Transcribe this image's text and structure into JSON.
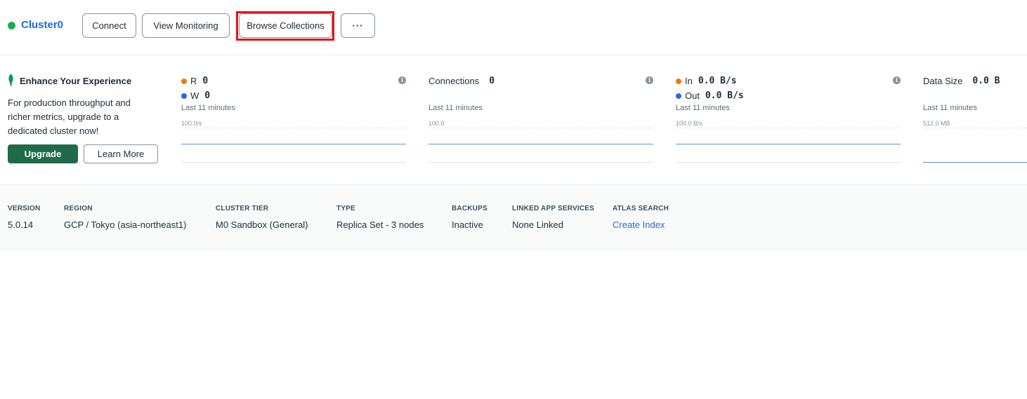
{
  "header": {
    "cluster_name": "Cluster0",
    "connect_label": "Connect",
    "monitoring_label": "View Monitoring",
    "browse_label": "Browse Collections",
    "more_label": "···"
  },
  "promo": {
    "title": "Enhance Your Experience",
    "text": "For production throughput and richer metrics, upgrade to a dedicated cluster now!",
    "upgrade_label": "Upgrade",
    "learn_label": "Learn More"
  },
  "metrics": [
    {
      "line1_label": "R",
      "line1_value": "0",
      "line2_label": "W",
      "line2_value": "0",
      "sub": "Last 11 minutes",
      "scale": "100.0/s",
      "info": "i"
    },
    {
      "line1_label": "Connections",
      "line1_value": "0",
      "sub": "Last 11 minutes",
      "scale": "100.0",
      "info": "i"
    },
    {
      "line1_label": "In",
      "line1_value": "0.0 B/s",
      "line2_label": "Out",
      "line2_value": "0.0 B/s",
      "sub": "Last 11 minutes",
      "scale": "100.0 B/s",
      "info": "i"
    },
    {
      "line1_label": "Data Size",
      "line1_value": "0.0 B",
      "sub": "Last 11 minutes",
      "scale": "512.0 MB"
    }
  ],
  "details": [
    {
      "label": "VERSION",
      "value": "5.0.14"
    },
    {
      "label": "REGION",
      "value": "GCP / Tokyo (asia-northeast1)"
    },
    {
      "label": "CLUSTER TIER",
      "value": "M0 Sandbox (General)"
    },
    {
      "label": "TYPE",
      "value": "Replica Set - 3 nodes"
    },
    {
      "label": "BACKUPS",
      "value": "Inactive"
    },
    {
      "label": "LINKED APP SERVICES",
      "value": "None Linked"
    },
    {
      "label": "ATLAS SEARCH",
      "value": "Create Index"
    }
  ],
  "colors": {
    "brand_green": "#1f6b49",
    "link_blue": "#1f6bd8",
    "status_green": "#1eaa52",
    "highlight_red": "#e4121c"
  },
  "icons": {
    "leaf": "leaf-icon",
    "info": "info-icon",
    "status": "status-dot"
  }
}
